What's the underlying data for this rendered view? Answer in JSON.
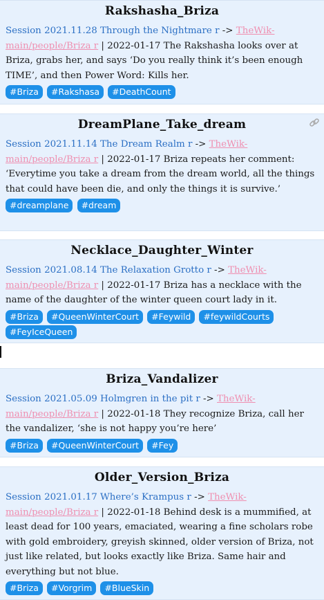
{
  "cards": [
    {
      "title": "Rakshasha_Briza",
      "session": "Session 2021.11.28 Through the Nightmare r",
      "arrow": " -> ",
      "wiki": "TheWik-main/people/Briza r",
      "sep": " | ",
      "text": "2022-01-17 The Rakshasha looks over at Briza, grabs her, and says ‘Do you really think it’s been enough TIME’, and then Power Word: Kills her.",
      "tags": [
        "#Briza",
        "#Rakshasa",
        "#DeathCount"
      ]
    },
    {
      "title": "DreamPlane_Take_dream",
      "session": "Session 2021.11.14 The Dream Realm r",
      "arrow": " -> ",
      "wiki": "TheWik-main/people/Briza r",
      "sep": " | ",
      "text": "2022-01-17 Briza repeats her comment: ‘Everytime you take a dream from the dream world, all the things that could have been die, and only the things it is survive.’",
      "tags": [
        "#dreamplane",
        "#dream"
      ]
    },
    {
      "title": "Necklace_Daughter_Winter",
      "session": "Session 2021.08.14 The Relaxation Grotto r",
      "arrow": " -> ",
      "wiki": "TheWik-main/people/Briza r",
      "sep": " | ",
      "text": "2022-01-17 Briza has a necklace with the name of the daughter of the winter queen court lady in it.",
      "tags": [
        "#Briza",
        "#QueenWinterCourt",
        "#Feywild",
        "#feywildCourts",
        "#FeyIceQueen"
      ]
    },
    {
      "title": "Briza_Vandalizer",
      "session": "Session 2021.05.09 Holmgren in the pit r",
      "arrow": " -> ",
      "wiki": "TheWik-main/people/Briza r",
      "sep": " | ",
      "text": "2022-01-18 They recognize Briza, call her the vandalizer, ‘she is not happy you’re here’",
      "tags": [
        "#Briza",
        "#QueenWinterCourt",
        "#Fey"
      ]
    },
    {
      "title": "Older_Version_Briza",
      "session": "Session 2021.01.17 Where’s Krampus r",
      "arrow": " -> ",
      "wiki": "TheWik-main/people/Briza r",
      "sep": " | ",
      "text": "2022-01-18 Behind desk is a mummified, at least dead for 100 years, emaciated, wearing a fine scholars robe with gold embroidery, greyish skinned, older version of Briza, not just like related, but looks exactly like Briza. Same hair and everything but not blue.",
      "tags": [
        "#Briza",
        "#Vorgrim",
        "#BlueSkin"
      ]
    }
  ]
}
